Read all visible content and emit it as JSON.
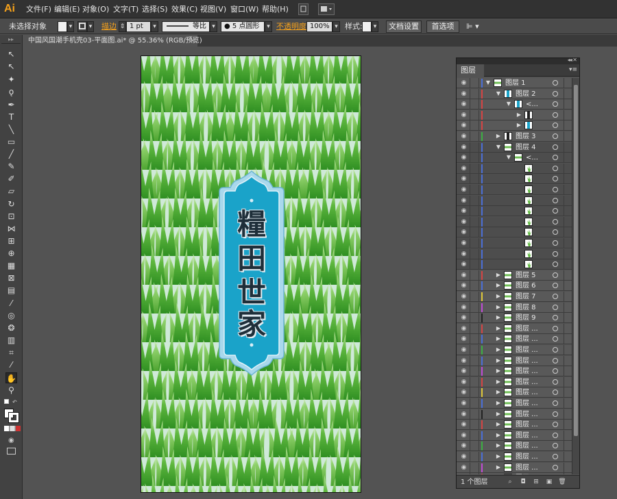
{
  "app": {
    "logo": "Ai"
  },
  "menu": [
    "文件(F)",
    "编辑(E)",
    "对象(O)",
    "文字(T)",
    "选择(S)",
    "效果(C)",
    "视图(V)",
    "窗口(W)",
    "帮助(H)"
  ],
  "control_bar": {
    "selection_status": "未选择对象",
    "stroke_label": "描边",
    "stroke_weight": "1 pt",
    "profile_label": "等比",
    "brush_label": "5 点圆形",
    "opacity_label": "不透明度",
    "opacity_value": "100%",
    "style_label": "样式:",
    "doc_setup_button": "文档设置",
    "preferences_button": "首选项"
  },
  "document": {
    "tab_title": "中国风国潮手机壳03-平面图.ai* @ 55.36% (RGB/预览)",
    "tab_close": "×"
  },
  "artwork": {
    "plaque_text": [
      "糧",
      "田",
      "世",
      "家"
    ],
    "colors": {
      "grass_light": "#8fd16b",
      "grass_dark": "#3f9e2a",
      "background": "#cfe9d8",
      "plaque_blue": "#1aa3c9",
      "plaque_border": "#a9d8ec"
    }
  },
  "layers_panel": {
    "title": "图层",
    "footer_count": "1 个图层",
    "rows": [
      {
        "indent": 0,
        "twisty": "▼",
        "name": "图层 1",
        "color": "#4b6fd6",
        "thumb": "green"
      },
      {
        "indent": 1,
        "twisty": "▼",
        "name": "图层 2",
        "color": "#d64545",
        "thumb": "blue"
      },
      {
        "indent": 2,
        "twisty": "▼",
        "name": "<...",
        "color": "#d64545",
        "thumb": "blue"
      },
      {
        "indent": 3,
        "twisty": "▶",
        "name": "",
        "color": "#d64545",
        "thumb": "dark"
      },
      {
        "indent": 3,
        "twisty": "▶",
        "name": "",
        "color": "#d64545",
        "thumb": "blue"
      },
      {
        "indent": 1,
        "twisty": "▶",
        "name": "图层 3",
        "color": "#3cb043",
        "thumb": "dark"
      },
      {
        "indent": 1,
        "twisty": "▼",
        "name": "图层 4",
        "color": "#4b6fd6",
        "thumb": "green"
      },
      {
        "indent": 2,
        "twisty": "▼",
        "name": "<...",
        "color": "#4b6fd6",
        "thumb": "green"
      },
      {
        "indent": 3,
        "twisty": "",
        "name": "",
        "color": "#4b6fd6",
        "thumb": "plant"
      },
      {
        "indent": 3,
        "twisty": "",
        "name": "",
        "color": "#4b6fd6",
        "thumb": "plant"
      },
      {
        "indent": 3,
        "twisty": "",
        "name": "",
        "color": "#4b6fd6",
        "thumb": "plant"
      },
      {
        "indent": 3,
        "twisty": "",
        "name": "",
        "color": "#4b6fd6",
        "thumb": "plant"
      },
      {
        "indent": 3,
        "twisty": "",
        "name": "",
        "color": "#4b6fd6",
        "thumb": "plant"
      },
      {
        "indent": 3,
        "twisty": "",
        "name": "",
        "color": "#4b6fd6",
        "thumb": "plant"
      },
      {
        "indent": 3,
        "twisty": "",
        "name": "",
        "color": "#4b6fd6",
        "thumb": "plant"
      },
      {
        "indent": 3,
        "twisty": "",
        "name": "",
        "color": "#4b6fd6",
        "thumb": "plant"
      },
      {
        "indent": 3,
        "twisty": "",
        "name": "",
        "color": "#4b6fd6",
        "thumb": "plant"
      },
      {
        "indent": 3,
        "twisty": "",
        "name": "",
        "color": "#4b6fd6",
        "thumb": "plant"
      },
      {
        "indent": 1,
        "twisty": "▶",
        "name": "图层 5",
        "color": "#d64545",
        "thumb": "green"
      },
      {
        "indent": 1,
        "twisty": "▶",
        "name": "图层 6",
        "color": "#4b6fd6",
        "thumb": "green"
      },
      {
        "indent": 1,
        "twisty": "▶",
        "name": "图层 7",
        "color": "#e0c93a",
        "thumb": "green"
      },
      {
        "indent": 1,
        "twisty": "▶",
        "name": "图层 8",
        "color": "#c04bd6",
        "thumb": "green"
      },
      {
        "indent": 1,
        "twisty": "▶",
        "name": "图层 9",
        "color": "#222222",
        "thumb": "green"
      },
      {
        "indent": 1,
        "twisty": "▶",
        "name": "图层 ...",
        "color": "#d64545",
        "thumb": "green"
      },
      {
        "indent": 1,
        "twisty": "▶",
        "name": "图层 ...",
        "color": "#4b6fd6",
        "thumb": "green"
      },
      {
        "indent": 1,
        "twisty": "▶",
        "name": "图层 ...",
        "color": "#3cb043",
        "thumb": "green"
      },
      {
        "indent": 1,
        "twisty": "▶",
        "name": "图层 ...",
        "color": "#4b6fd6",
        "thumb": "green"
      },
      {
        "indent": 1,
        "twisty": "▶",
        "name": "图层 ...",
        "color": "#c04bd6",
        "thumb": "green"
      },
      {
        "indent": 1,
        "twisty": "▶",
        "name": "图层 ...",
        "color": "#d64545",
        "thumb": "green"
      },
      {
        "indent": 1,
        "twisty": "▶",
        "name": "图层 ...",
        "color": "#e0c93a",
        "thumb": "green"
      },
      {
        "indent": 1,
        "twisty": "▶",
        "name": "图层 ...",
        "color": "#4b6fd6",
        "thumb": "green"
      },
      {
        "indent": 1,
        "twisty": "▶",
        "name": "图层 ...",
        "color": "#222222",
        "thumb": "green"
      },
      {
        "indent": 1,
        "twisty": "▶",
        "name": "图层 ...",
        "color": "#d64545",
        "thumb": "green"
      },
      {
        "indent": 1,
        "twisty": "▶",
        "name": "图层 ...",
        "color": "#4b6fd6",
        "thumb": "green"
      },
      {
        "indent": 1,
        "twisty": "▶",
        "name": "图层 ...",
        "color": "#3cb043",
        "thumb": "green"
      },
      {
        "indent": 1,
        "twisty": "▶",
        "name": "图层 ...",
        "color": "#4b6fd6",
        "thumb": "green"
      },
      {
        "indent": 1,
        "twisty": "▶",
        "name": "图层 ...",
        "color": "#c04bd6",
        "thumb": "green"
      },
      {
        "indent": 1,
        "twisty": "▶",
        "name": "图层 ...",
        "color": "#d64545",
        "thumb": "green"
      }
    ]
  },
  "tools": [
    {
      "name": "selection-tool-icon",
      "glyph": "↖"
    },
    {
      "name": "direct-selection-tool-icon",
      "glyph": "↖"
    },
    {
      "name": "magic-wand-tool-icon",
      "glyph": "✦"
    },
    {
      "name": "lasso-tool-icon",
      "glyph": "ǫ"
    },
    {
      "name": "pen-tool-icon",
      "glyph": "✒"
    },
    {
      "name": "type-tool-icon",
      "glyph": "T"
    },
    {
      "name": "line-tool-icon",
      "glyph": "╲"
    },
    {
      "name": "rectangle-tool-icon",
      "glyph": "▭"
    },
    {
      "name": "paintbrush-tool-icon",
      "glyph": "╱"
    },
    {
      "name": "pencil-tool-icon",
      "glyph": "✎"
    },
    {
      "name": "blob-brush-tool-icon",
      "glyph": "✐"
    },
    {
      "name": "eraser-tool-icon",
      "glyph": "▱"
    },
    {
      "name": "rotate-tool-icon",
      "glyph": "↻"
    },
    {
      "name": "scale-tool-icon",
      "glyph": "⊡"
    },
    {
      "name": "width-tool-icon",
      "glyph": "⋈"
    },
    {
      "name": "free-transform-tool-icon",
      "glyph": "⊞"
    },
    {
      "name": "shape-builder-tool-icon",
      "glyph": "⊕"
    },
    {
      "name": "perspective-grid-tool-icon",
      "glyph": "▦"
    },
    {
      "name": "mesh-tool-icon",
      "glyph": "⊠"
    },
    {
      "name": "gradient-tool-icon",
      "glyph": "▤"
    },
    {
      "name": "eyedropper-tool-icon",
      "glyph": "⁄"
    },
    {
      "name": "blend-tool-icon",
      "glyph": "◎"
    },
    {
      "name": "symbol-sprayer-tool-icon",
      "glyph": "❂"
    },
    {
      "name": "column-graph-tool-icon",
      "glyph": "▥"
    },
    {
      "name": "artboard-tool-icon",
      "glyph": "⌗"
    },
    {
      "name": "slice-tool-icon",
      "glyph": "⁄"
    },
    {
      "name": "hand-tool-icon",
      "glyph": "✋"
    },
    {
      "name": "zoom-tool-icon",
      "glyph": "⚲"
    }
  ]
}
